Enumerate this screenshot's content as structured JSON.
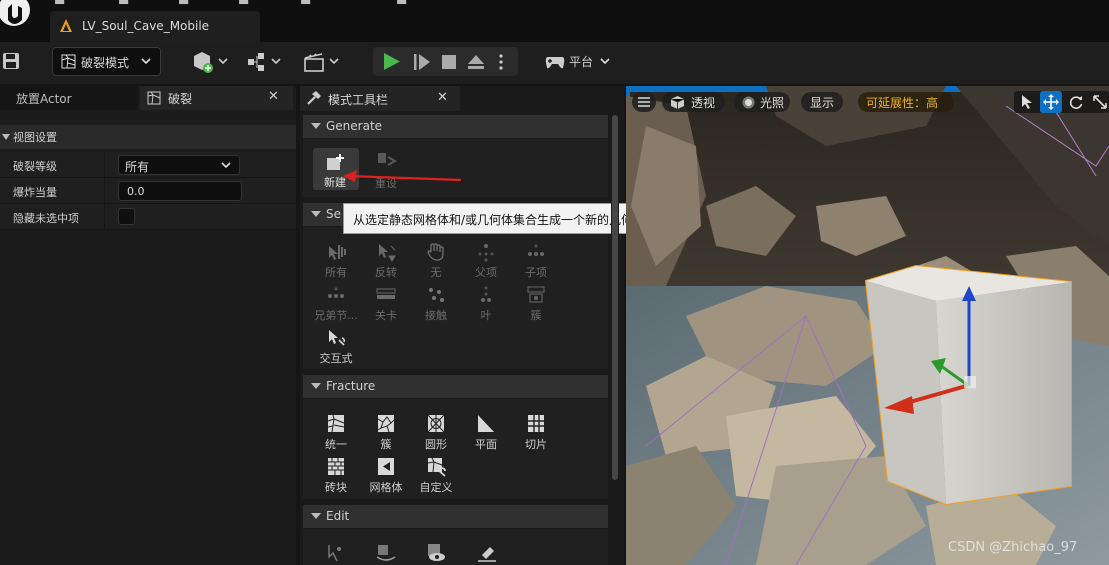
{
  "document_tab": {
    "title": "LV_Soul_Cave_Mobile"
  },
  "toolbar": {
    "mode_label": "破裂模式",
    "platform_label": "平台"
  },
  "left_panel": {
    "tabs": [
      {
        "label": "放置Actor"
      },
      {
        "label": "破裂"
      }
    ],
    "section_title": "视图设置",
    "properties": [
      {
        "name": "破裂等级",
        "value": "所有"
      },
      {
        "name": "爆炸当量",
        "value": "0.0"
      },
      {
        "name": "隐藏未选中项",
        "value": ""
      }
    ]
  },
  "mode_panel": {
    "tab_label": "模式工具栏",
    "sections": {
      "generate": {
        "title": "Generate",
        "tools": [
          {
            "label": "新建",
            "icon": "new-asset-icon"
          },
          {
            "label": "重设",
            "icon": "reset-icon"
          }
        ]
      },
      "select": {
        "title": "Se",
        "tools": [
          {
            "label": "所有",
            "icon": "select-all-icon"
          },
          {
            "label": "反转",
            "icon": "invert-icon"
          },
          {
            "label": "无",
            "icon": "none-icon"
          },
          {
            "label": "父项",
            "icon": "parent-icon"
          },
          {
            "label": "子项",
            "icon": "children-icon"
          },
          {
            "label": "兄弟节...",
            "icon": "siblings-icon"
          },
          {
            "label": "关卡",
            "icon": "level-icon"
          },
          {
            "label": "接触",
            "icon": "contact-icon"
          },
          {
            "label": "叶",
            "icon": "leaf-icon"
          },
          {
            "label": "簇",
            "icon": "cluster-icon"
          },
          {
            "label": "交互式",
            "icon": "interactive-icon"
          }
        ]
      },
      "fracture": {
        "title": "Fracture",
        "tools": [
          {
            "label": "统一",
            "icon": "uniform-icon"
          },
          {
            "label": "簇",
            "icon": "cluster-icon"
          },
          {
            "label": "圆形",
            "icon": "radial-icon"
          },
          {
            "label": "平面",
            "icon": "planar-icon"
          },
          {
            "label": "切片",
            "icon": "slice-icon"
          },
          {
            "label": "砖块",
            "icon": "brick-icon"
          },
          {
            "label": "网格体",
            "icon": "mesh-icon"
          },
          {
            "label": "自定义",
            "icon": "custom-icon"
          }
        ]
      },
      "edit": {
        "title": "Edit"
      }
    },
    "tooltip": "从选定静态网格体和/或几何体集合生成一个新的几何体集合资产。几何体集合是支持破裂的资产。"
  },
  "viewport": {
    "perspective_label": "透视",
    "lighting_label": "光照",
    "show_label": "显示",
    "scalability_label": "可延展性：高"
  },
  "watermark": "CSDN @Zhichao_97",
  "colors": {
    "accent_blue": "#0e70c0",
    "play_green": "#4ab84a",
    "tooltip_bg": "#f2f2f2",
    "arrow_red": "#e02020",
    "scalability_yellow": "#f0b020",
    "selection_orange": "#f0a020"
  }
}
